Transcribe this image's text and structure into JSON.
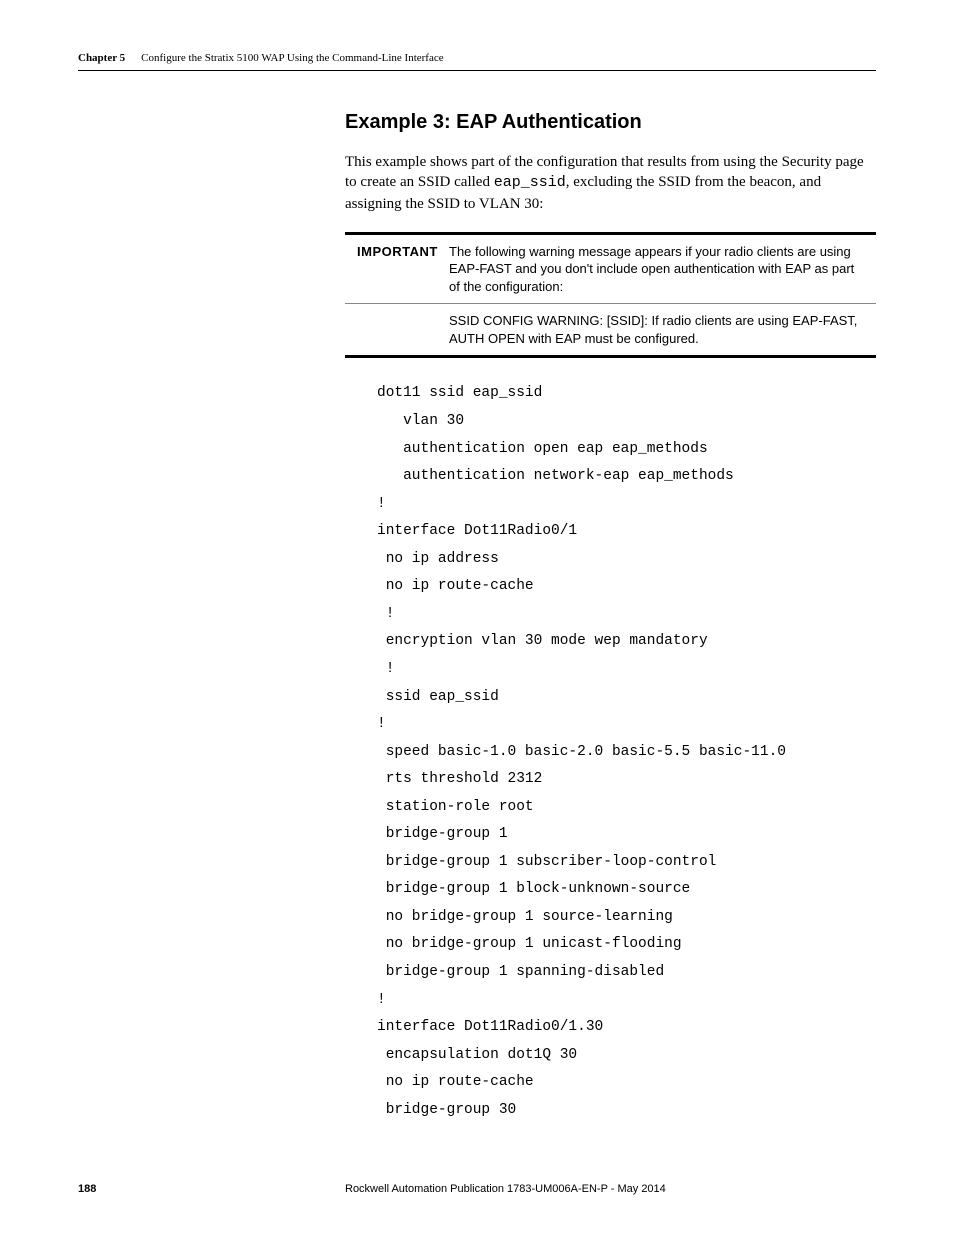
{
  "header": {
    "chapter_label": "Chapter 5",
    "chapter_title": "Configure the Stratix 5100 WAP Using the Command-Line Interface"
  },
  "section": {
    "heading": "Example 3: EAP Authentication",
    "paragraph_pre": "This example shows part of the configuration that results from using the Security page to create an SSID called ",
    "paragraph_code": "eap_ssid",
    "paragraph_post": ", excluding the SSID from the beacon, and assigning the SSID to VLAN 30:"
  },
  "important": {
    "label": "IMPORTANT",
    "row1": "The following warning message appears if your radio clients are using EAP-FAST and you don't include open authentication with EAP as part of the configuration:",
    "row2": "SSID CONFIG WARNING: [SSID]: If radio clients are using EAP-FAST, AUTH OPEN with EAP must be configured."
  },
  "code": "dot11 ssid eap_ssid\n   vlan 30\n   authentication open eap eap_methods\n   authentication network-eap eap_methods\n!\ninterface Dot11Radio0/1\n no ip address\n no ip route-cache\n !\n encryption vlan 30 mode wep mandatory\n !\n ssid eap_ssid\n!\n speed basic-1.0 basic-2.0 basic-5.5 basic-11.0\n rts threshold 2312\n station-role root\n bridge-group 1\n bridge-group 1 subscriber-loop-control\n bridge-group 1 block-unknown-source\n no bridge-group 1 source-learning\n no bridge-group 1 unicast-flooding\n bridge-group 1 spanning-disabled\n!\ninterface Dot11Radio0/1.30\n encapsulation dot1Q 30\n no ip route-cache\n bridge-group 30",
  "footer": {
    "page": "188",
    "publication": "Rockwell Automation Publication 1783-UM006A-EN-P - May 2014"
  }
}
